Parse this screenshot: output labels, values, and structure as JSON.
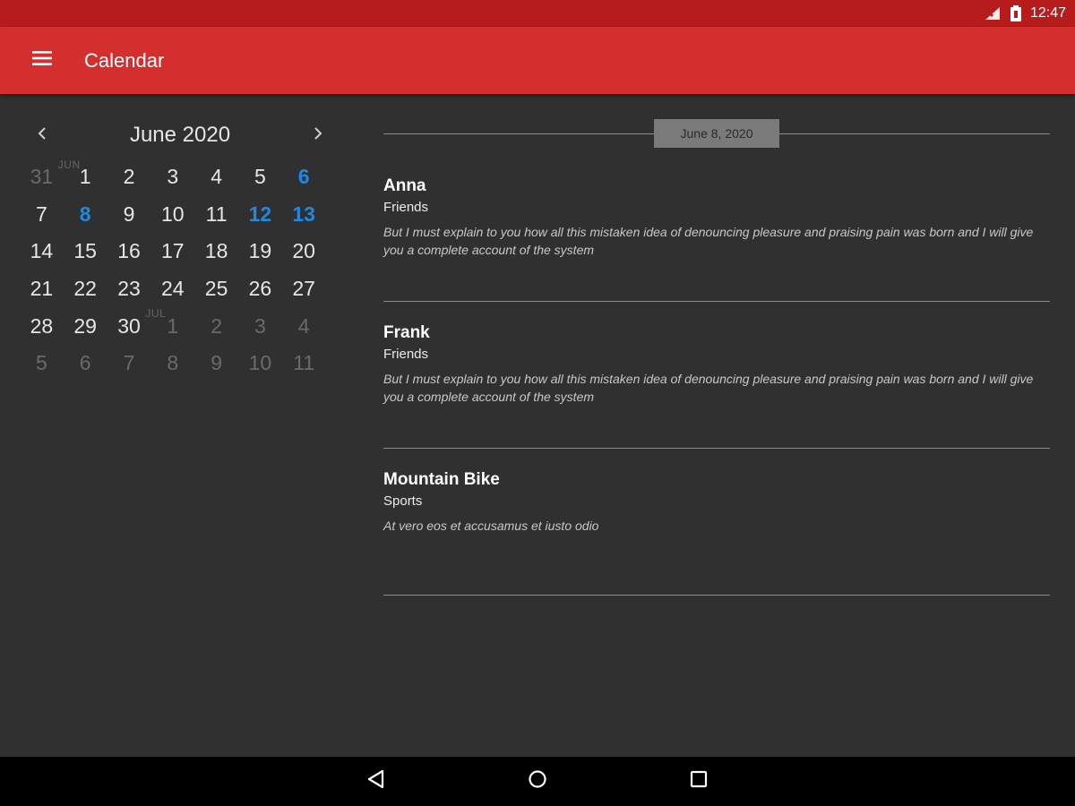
{
  "status_bar": {
    "time": "12:47",
    "icons": [
      "signal-icon",
      "battery-icon"
    ]
  },
  "app_bar": {
    "title": "Calendar",
    "menu_icon": "menu-icon",
    "color": "#d32f2f",
    "status_color": "#b71c1c"
  },
  "calendar": {
    "month_label": "June 2020",
    "prev_icon": "chevron-left-icon",
    "next_icon": "chevron-right-icon",
    "event_day_color": "#1e88e5",
    "weeks": [
      [
        {
          "d": "31",
          "m": true
        },
        {
          "d": "1",
          "tag": "JUN"
        },
        {
          "d": "2"
        },
        {
          "d": "3"
        },
        {
          "d": "4"
        },
        {
          "d": "5"
        },
        {
          "d": "6",
          "e": true
        }
      ],
      [
        {
          "d": "7"
        },
        {
          "d": "8",
          "e": true
        },
        {
          "d": "9"
        },
        {
          "d": "10"
        },
        {
          "d": "11"
        },
        {
          "d": "12",
          "e": true
        },
        {
          "d": "13",
          "e": true
        }
      ],
      [
        {
          "d": "14"
        },
        {
          "d": "15"
        },
        {
          "d": "16"
        },
        {
          "d": "17"
        },
        {
          "d": "18"
        },
        {
          "d": "19"
        },
        {
          "d": "20"
        }
      ],
      [
        {
          "d": "21"
        },
        {
          "d": "22"
        },
        {
          "d": "23"
        },
        {
          "d": "24"
        },
        {
          "d": "25"
        },
        {
          "d": "26"
        },
        {
          "d": "27"
        }
      ],
      [
        {
          "d": "28"
        },
        {
          "d": "29"
        },
        {
          "d": "30"
        },
        {
          "d": "1",
          "m": true,
          "tag": "JUL"
        },
        {
          "d": "2",
          "m": true
        },
        {
          "d": "3",
          "m": true
        },
        {
          "d": "4",
          "m": true
        }
      ],
      [
        {
          "d": "5",
          "m": true
        },
        {
          "d": "6",
          "m": true
        },
        {
          "d": "7",
          "m": true
        },
        {
          "d": "8",
          "m": true
        },
        {
          "d": "9",
          "m": true
        },
        {
          "d": "10",
          "m": true
        },
        {
          "d": "11",
          "m": true
        }
      ]
    ]
  },
  "agenda": {
    "date_label": "June 8, 2020",
    "events": [
      {
        "title": "Anna",
        "category": "Friends",
        "description": "But I must explain to you how all this mistaken idea of denouncing pleasure and praising pain was born and I will give you a complete account of the system"
      },
      {
        "title": "Frank",
        "category": "Friends",
        "description": "But I must explain to you how all this mistaken idea of denouncing pleasure and praising pain was born and I will give you a complete account of the system"
      },
      {
        "title": "Mountain Bike",
        "category": "Sports",
        "description": "At vero eos et accusamus et iusto odio"
      }
    ]
  },
  "nav_bar": {
    "icons": [
      "back-icon",
      "home-icon",
      "recents-icon"
    ]
  }
}
